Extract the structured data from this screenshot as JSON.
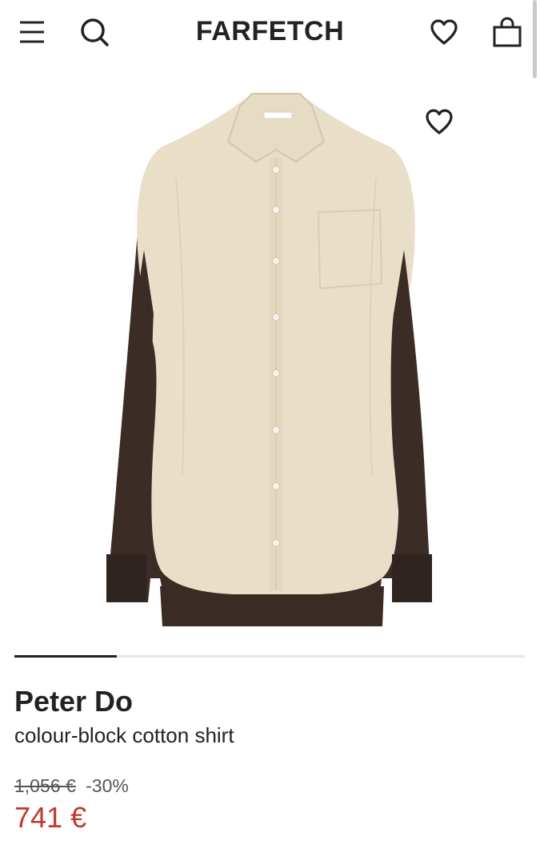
{
  "header": {
    "logo": "FARFETCH",
    "icons": [
      "menu-icon",
      "search-icon",
      "wishlist-icon",
      "bag-icon"
    ]
  },
  "gallery": {
    "image_alt": "Peter Do colour-block cotton shirt",
    "colors": {
      "body": "#e9dfc9",
      "contrast": "#3b2d26"
    },
    "progress": 0.2
  },
  "product": {
    "brand": "Peter Do",
    "name": "colour-block cotton shirt",
    "original_price": "1,056 €",
    "discount": "-30%",
    "price": "741 €"
  },
  "colors": {
    "sale": "#c0392b",
    "text": "#222222"
  }
}
